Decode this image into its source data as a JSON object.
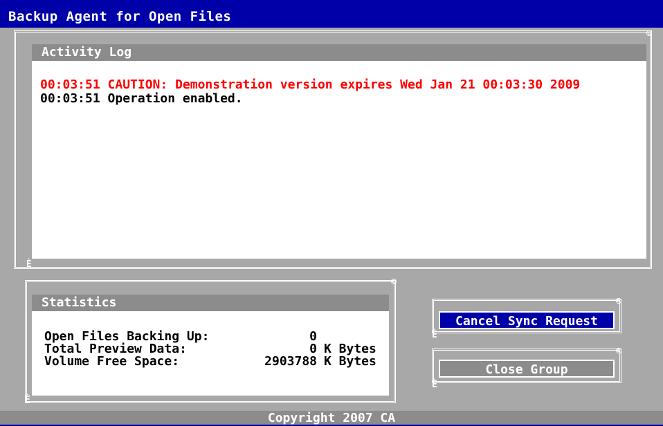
{
  "window": {
    "title": "Backup Agent for Open Files"
  },
  "activity_log": {
    "title": "Activity Log",
    "entries": [
      {
        "text": "00:03:51 CAUTION: Demonstration version expires Wed Jan 21 00:03:30 2009",
        "color": "#ff0000"
      },
      {
        "text": "00:03:51 Operation enabled.",
        "color": "#000000"
      }
    ]
  },
  "statistics": {
    "title": "Statistics",
    "rows": [
      {
        "label": "Open Files Backing Up:",
        "value": "0",
        "unit": ""
      },
      {
        "label": "Total Preview Data:",
        "value": "0",
        "unit": "K Bytes"
      },
      {
        "label": "Volume Free Space:",
        "value": "2903788",
        "unit": "K Bytes"
      }
    ]
  },
  "buttons": {
    "cancel_sync": "Cancel Sync Request",
    "close_group": "Close Group"
  },
  "footer": {
    "copyright": "Copyright 2007 CA"
  },
  "colors": {
    "background": "#0000a8",
    "panel_header": "#8c8c8c",
    "highlight_button": "#0000a8",
    "caution_text": "#ff0000"
  }
}
